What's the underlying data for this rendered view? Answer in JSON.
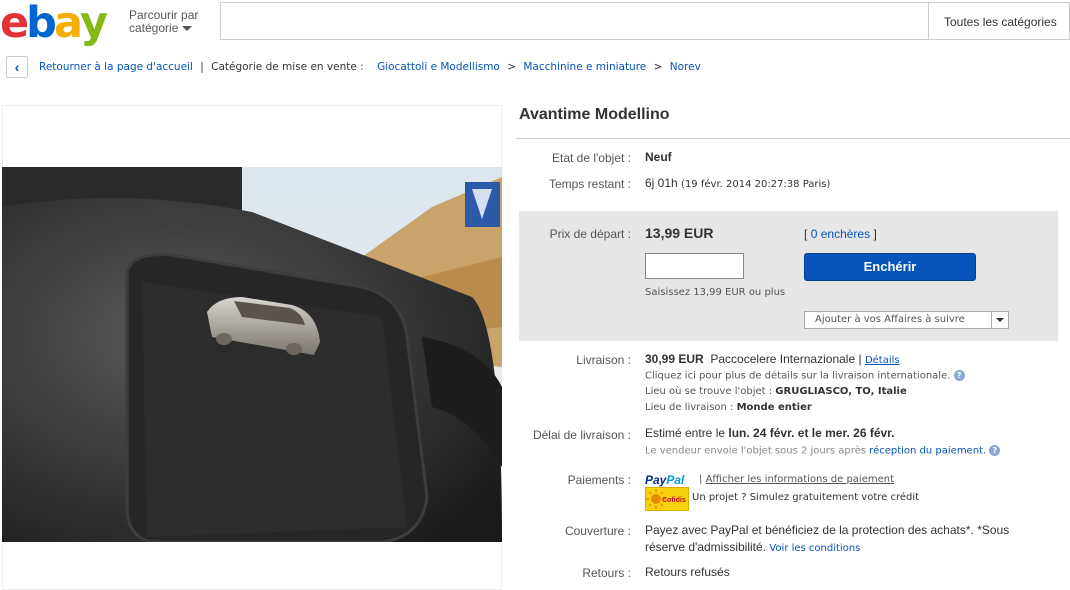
{
  "header": {
    "logo": [
      "e",
      "b",
      "a",
      "y"
    ],
    "logo_colors": [
      "#e53238",
      "#0064d2",
      "#f5af02",
      "#86b817"
    ],
    "browse_line1": "Parcourir par",
    "browse_line2": "catégorie",
    "search_placeholder": "",
    "category_select": "Toutes les catégories"
  },
  "breadcrumb": {
    "back": "Retourner à la page d'accueil",
    "divider": "|",
    "category_label": "Catégorie de mise en vente :",
    "items": [
      "Giocattoli e Modellismo",
      "Macchinine e miniature",
      "Norev"
    ],
    "separator": ">"
  },
  "item": {
    "title": "Avantime Modellino",
    "condition_label": "Etat de l'objet :",
    "condition_value": "Neuf",
    "time_label": "Temps restant :",
    "time_value": "6j 01h",
    "time_detail": "(19 févr. 2014  20:27:38 Paris)"
  },
  "bid": {
    "price_label": "Prix de départ :",
    "price": "13,99 EUR",
    "bids_open": "[",
    "bids_count": "0",
    "bids_text": "enchères",
    "bids_close": "]",
    "input_value": "",
    "button": "Enchérir",
    "hint": "Saisissez 13,99 EUR ou plus",
    "watch": "Ajouter à vos Affaires à suivre"
  },
  "shipping": {
    "label": "Livraison :",
    "price": "30,99 EUR",
    "service": "Paccocelere Internazionale",
    "divider": "|",
    "details_link": "Détails",
    "intl_note": "Cliquez ici pour plus de détails sur la livraison internationale.",
    "location_label": "Lieu où se trouve l'objet :",
    "location_value": "GRUGLIASCO, TO, Italie",
    "ships_to_label": "Lieu de livraison :",
    "ships_to_value": "Monde entier"
  },
  "delivery": {
    "label": "Délai de livraison :",
    "prefix": "Estimé entre le",
    "date1": "lun. 24 févr.",
    "mid": "et le",
    "date2": "mer. 26 févr.",
    "note": "Le vendeur envoie l'objet sous 2 jours après",
    "note_link": "réception du paiement."
  },
  "payments": {
    "label": "Paiements :",
    "paypal": [
      "Pay",
      "Pal"
    ],
    "divider": "|",
    "info_link": "Afficher les informations de paiement",
    "cofidis": "Cofidis",
    "credit_text": "Un projet ? Simulez gratuitement votre crédit"
  },
  "coverage": {
    "label": "Couverture :",
    "line1": "Payez avec PayPal et bénéficiez de la protection des achats*. *Sous",
    "line2": "réserve d'admissibilité.",
    "link": "Voir les conditions"
  },
  "returns": {
    "label": "Retours :",
    "value": "Retours refusés"
  }
}
